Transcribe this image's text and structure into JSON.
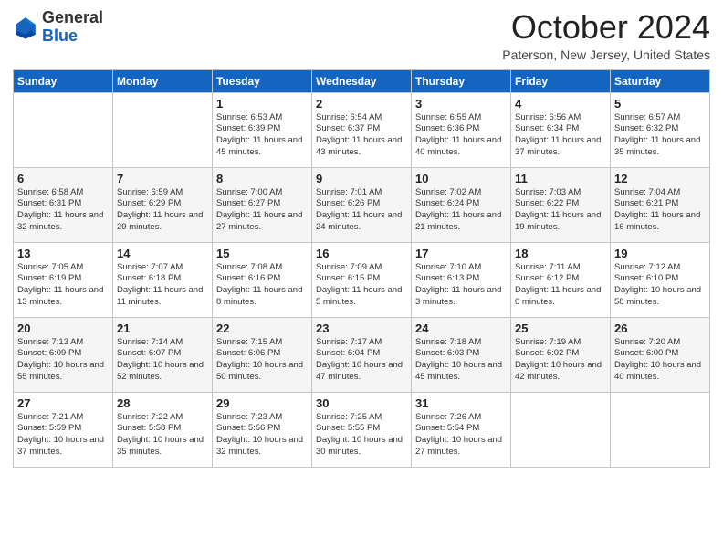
{
  "logo": {
    "general": "General",
    "blue": "Blue"
  },
  "header": {
    "month": "October 2024",
    "location": "Paterson, New Jersey, United States"
  },
  "weekdays": [
    "Sunday",
    "Monday",
    "Tuesday",
    "Wednesday",
    "Thursday",
    "Friday",
    "Saturday"
  ],
  "weeks": [
    [
      null,
      null,
      {
        "day": "1",
        "sunrise": "6:53 AM",
        "sunset": "6:39 PM",
        "daylight": "11 hours and 45 minutes."
      },
      {
        "day": "2",
        "sunrise": "6:54 AM",
        "sunset": "6:37 PM",
        "daylight": "11 hours and 43 minutes."
      },
      {
        "day": "3",
        "sunrise": "6:55 AM",
        "sunset": "6:36 PM",
        "daylight": "11 hours and 40 minutes."
      },
      {
        "day": "4",
        "sunrise": "6:56 AM",
        "sunset": "6:34 PM",
        "daylight": "11 hours and 37 minutes."
      },
      {
        "day": "5",
        "sunrise": "6:57 AM",
        "sunset": "6:32 PM",
        "daylight": "11 hours and 35 minutes."
      }
    ],
    [
      {
        "day": "6",
        "sunrise": "6:58 AM",
        "sunset": "6:31 PM",
        "daylight": "11 hours and 32 minutes."
      },
      {
        "day": "7",
        "sunrise": "6:59 AM",
        "sunset": "6:29 PM",
        "daylight": "11 hours and 29 minutes."
      },
      {
        "day": "8",
        "sunrise": "7:00 AM",
        "sunset": "6:27 PM",
        "daylight": "11 hours and 27 minutes."
      },
      {
        "day": "9",
        "sunrise": "7:01 AM",
        "sunset": "6:26 PM",
        "daylight": "11 hours and 24 minutes."
      },
      {
        "day": "10",
        "sunrise": "7:02 AM",
        "sunset": "6:24 PM",
        "daylight": "11 hours and 21 minutes."
      },
      {
        "day": "11",
        "sunrise": "7:03 AM",
        "sunset": "6:22 PM",
        "daylight": "11 hours and 19 minutes."
      },
      {
        "day": "12",
        "sunrise": "7:04 AM",
        "sunset": "6:21 PM",
        "daylight": "11 hours and 16 minutes."
      }
    ],
    [
      {
        "day": "13",
        "sunrise": "7:05 AM",
        "sunset": "6:19 PM",
        "daylight": "11 hours and 13 minutes."
      },
      {
        "day": "14",
        "sunrise": "7:07 AM",
        "sunset": "6:18 PM",
        "daylight": "11 hours and 11 minutes."
      },
      {
        "day": "15",
        "sunrise": "7:08 AM",
        "sunset": "6:16 PM",
        "daylight": "11 hours and 8 minutes."
      },
      {
        "day": "16",
        "sunrise": "7:09 AM",
        "sunset": "6:15 PM",
        "daylight": "11 hours and 5 minutes."
      },
      {
        "day": "17",
        "sunrise": "7:10 AM",
        "sunset": "6:13 PM",
        "daylight": "11 hours and 3 minutes."
      },
      {
        "day": "18",
        "sunrise": "7:11 AM",
        "sunset": "6:12 PM",
        "daylight": "11 hours and 0 minutes."
      },
      {
        "day": "19",
        "sunrise": "7:12 AM",
        "sunset": "6:10 PM",
        "daylight": "10 hours and 58 minutes."
      }
    ],
    [
      {
        "day": "20",
        "sunrise": "7:13 AM",
        "sunset": "6:09 PM",
        "daylight": "10 hours and 55 minutes."
      },
      {
        "day": "21",
        "sunrise": "7:14 AM",
        "sunset": "6:07 PM",
        "daylight": "10 hours and 52 minutes."
      },
      {
        "day": "22",
        "sunrise": "7:15 AM",
        "sunset": "6:06 PM",
        "daylight": "10 hours and 50 minutes."
      },
      {
        "day": "23",
        "sunrise": "7:17 AM",
        "sunset": "6:04 PM",
        "daylight": "10 hours and 47 minutes."
      },
      {
        "day": "24",
        "sunrise": "7:18 AM",
        "sunset": "6:03 PM",
        "daylight": "10 hours and 45 minutes."
      },
      {
        "day": "25",
        "sunrise": "7:19 AM",
        "sunset": "6:02 PM",
        "daylight": "10 hours and 42 minutes."
      },
      {
        "day": "26",
        "sunrise": "7:20 AM",
        "sunset": "6:00 PM",
        "daylight": "10 hours and 40 minutes."
      }
    ],
    [
      {
        "day": "27",
        "sunrise": "7:21 AM",
        "sunset": "5:59 PM",
        "daylight": "10 hours and 37 minutes."
      },
      {
        "day": "28",
        "sunrise": "7:22 AM",
        "sunset": "5:58 PM",
        "daylight": "10 hours and 35 minutes."
      },
      {
        "day": "29",
        "sunrise": "7:23 AM",
        "sunset": "5:56 PM",
        "daylight": "10 hours and 32 minutes."
      },
      {
        "day": "30",
        "sunrise": "7:25 AM",
        "sunset": "5:55 PM",
        "daylight": "10 hours and 30 minutes."
      },
      {
        "day": "31",
        "sunrise": "7:26 AM",
        "sunset": "5:54 PM",
        "daylight": "10 hours and 27 minutes."
      },
      null,
      null
    ]
  ],
  "labels": {
    "sunrise": "Sunrise:",
    "sunset": "Sunset:",
    "daylight": "Daylight:"
  }
}
